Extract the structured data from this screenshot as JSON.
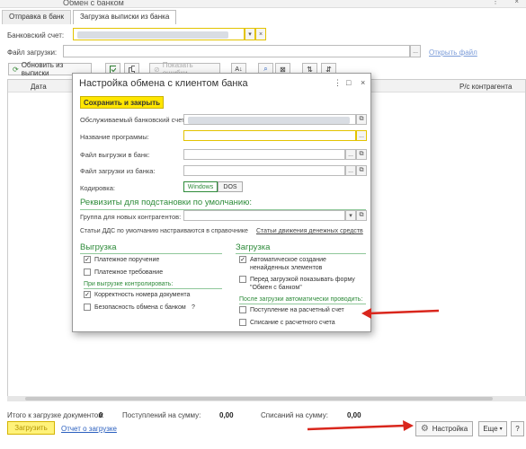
{
  "window": {
    "title": "Обмен с банком",
    "dots": "⋮",
    "close": "×"
  },
  "tabs": [
    {
      "label": "Отправка в банк"
    },
    {
      "label": "Загрузка выписки из банка"
    }
  ],
  "bank_account": {
    "label": "Банковский счет:",
    "dropdown": "▾",
    "clear": "×"
  },
  "upload_file": {
    "label": "Файл загрузки:",
    "dots": "...",
    "open_link": "Открыть файл"
  },
  "toolbar": {
    "refresh": "Обновить из выписки",
    "show_errors": "Показать ошибки"
  },
  "grid": {
    "col_date": "Дата",
    "col_account": "Р/с контрагента"
  },
  "footer": {
    "total_docs_label": "Итого к загрузке документов:",
    "total_docs_value": "0",
    "incoming_label": "Поступлений на сумму:",
    "incoming_value": "0,00",
    "outgoing_label": "Списаний на сумму:",
    "outgoing_value": "0,00",
    "upload_button": "Загрузить",
    "report_link": "Отчет о загрузке",
    "settings_button": "Настройка",
    "more_button": "Еще",
    "help_button": "?"
  },
  "dialog": {
    "title": "Настройка обмена с клиентом банка",
    "menu_icon": "⋮",
    "maximize_icon": "□",
    "close_icon": "×",
    "save_button": "Сохранить и закрыть",
    "served_account_label": "Обслуживаемый банковский счет:",
    "program_label": "Название программы:",
    "export_file_label": "Файл выгрузки в банк:",
    "import_file_label": "Файл загрузки из банка:",
    "encoding_label": "Кодировка:",
    "encoding_options": [
      "Windows",
      "DOS"
    ],
    "encoding_selected": "Windows",
    "defaults_header": "Реквизиты для подстановки по умолчанию:",
    "group_label": "Группа для новых контрагентов:",
    "dds_note": "Статьи ДДС по умолчанию настраиваются в справочнике",
    "dds_link": "Статьи движения денежных средств",
    "export": {
      "header": "Выгрузка",
      "payment_order": {
        "label": "Платежное поручение",
        "checked": true
      },
      "payment_request": {
        "label": "Платежное требование",
        "checked": false
      },
      "control_header": "При выгрузке контролировать:",
      "account_correct": {
        "label": "Корректность номера документа",
        "checked": true
      },
      "safe_exchange": {
        "label": "Безопасность обмена с банком",
        "checked": false,
        "help": "?"
      }
    },
    "import": {
      "header": "Загрузка",
      "auto_create": {
        "label": "Автоматическое создание ненайденных элементов",
        "checked": true
      },
      "show_form": {
        "label": "Перед загрузкой показывать форму \"Обмен с банком\"",
        "checked": false
      },
      "after_header": "После загрузки автоматически проводить:",
      "receipt": {
        "label": "Поступление на расчетный счет",
        "checked": false
      },
      "writeoff": {
        "label": "Списание с расчетного счета",
        "checked": false
      }
    }
  },
  "colors": {
    "accent_yellow": "#ffe600",
    "section_green": "#2e8b3a",
    "link_blue": "#2a5fbf",
    "arrow_red": "#d9261c"
  }
}
